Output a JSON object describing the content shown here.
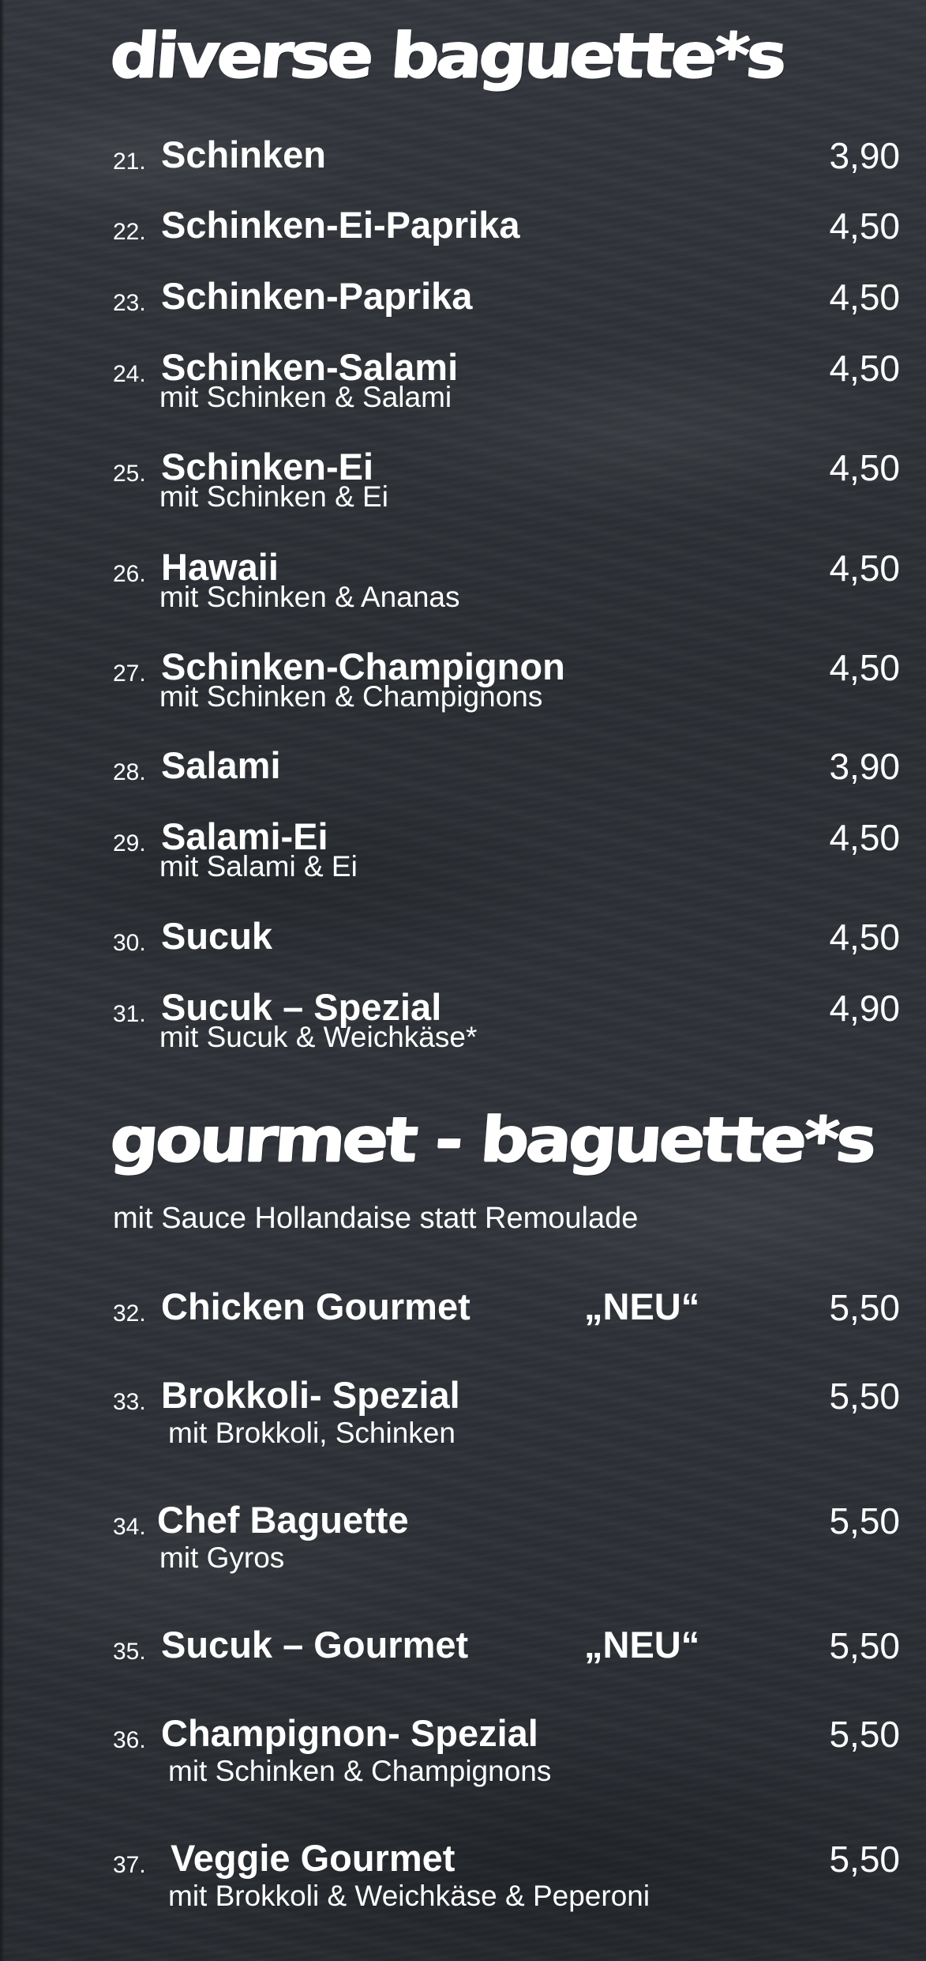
{
  "sections": {
    "diverse": {
      "title": "diverse baguette*s",
      "items": [
        {
          "num": "21.",
          "name": "Schinken",
          "price": "3,90"
        },
        {
          "num": "22.",
          "name": "Schinken-Ei-Paprika",
          "price": "4,50"
        },
        {
          "num": "23.",
          "name": "Schinken-Paprika",
          "price": "4,50"
        },
        {
          "num": "24.",
          "name": "Schinken-Salami",
          "desc": "mit Schinken & Salami",
          "price": "4,50"
        },
        {
          "num": "25.",
          "name": "Schinken-Ei",
          "desc": "mit Schinken & Ei",
          "price": "4,50"
        },
        {
          "num": "26.",
          "name": "Hawaii",
          "desc": "mit Schinken & Ananas",
          "price": "4,50"
        },
        {
          "num": "27.",
          "name": "Schinken-Champignon",
          "desc": "mit Schinken & Champignons",
          "price": "4,50"
        },
        {
          "num": "28.",
          "name": "Salami",
          "price": "3,90"
        },
        {
          "num": "29.",
          "name": "Salami-Ei",
          "desc": "mit Salami & Ei",
          "price": "4,50"
        },
        {
          "num": "30.",
          "name": "Sucuk",
          "price": "4,50"
        },
        {
          "num": "31.",
          "name": "Sucuk – Spezial",
          "desc": "mit Sucuk & Weichkäse*",
          "price": "4,90"
        }
      ]
    },
    "gourmet": {
      "title": "gourmet - baguette*s",
      "note": "mit Sauce Hollandaise statt Remoulade",
      "items": [
        {
          "num": "32.",
          "name": "Chicken Gourmet",
          "badge": "„NEU“",
          "price": "5,50"
        },
        {
          "num": "33.",
          "name": "Brokkoli- Spezial",
          "desc": "mit Brokkoli, Schinken",
          "price": "5,50"
        },
        {
          "num": "34.",
          "name": "Chef Baguette",
          "desc": "mit Gyros",
          "price": "5,50"
        },
        {
          "num": "35.",
          "name": "Sucuk – Gourmet",
          "badge": "„NEU“",
          "price": "5,50"
        },
        {
          "num": "36.",
          "name": "Champignon- Spezial",
          "desc": "mit Schinken & Champignons",
          "price": "5,50"
        },
        {
          "num": "37.",
          "name": "Veggie Gourmet",
          "desc": "mit Brokkoli & Weichkäse & Peperoni",
          "price": "5,50"
        }
      ]
    }
  }
}
